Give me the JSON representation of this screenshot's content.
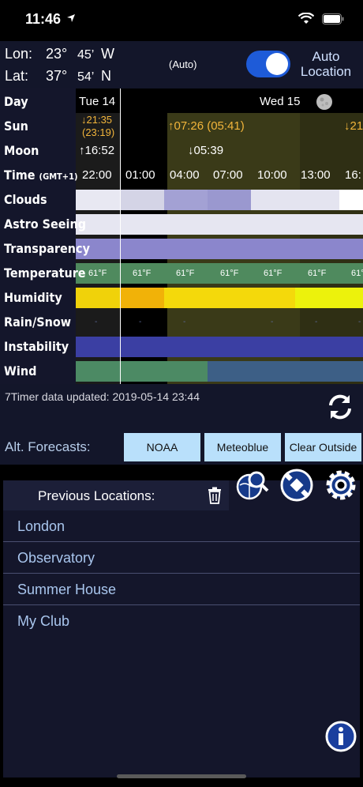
{
  "status": {
    "time": "11:46"
  },
  "location": {
    "lon_label": "Lon:",
    "lon_deg": "23°",
    "lon_min": "45’",
    "lon_dir": "W",
    "lat_label": "Lat:",
    "lat_deg": "37°",
    "lat_min": "54’",
    "lat_dir": "N",
    "auto_tag": "(Auto)",
    "auto_location_line1": "Auto",
    "auto_location_line2": "Location",
    "auto_location_enabled": true
  },
  "rows": {
    "day": "Day",
    "sun": "Sun",
    "moon": "Moon",
    "time": "Time",
    "time_zone": "(GMT+1)",
    "clouds": "Clouds",
    "seeing": "Astro Seeing",
    "transparency": "Transparency",
    "temperature": "Temperature",
    "humidity": "Humidity",
    "rain": "Rain/Snow",
    "instability": "Instability",
    "wind": "Wind"
  },
  "days": {
    "day1": "Tue 14",
    "day2": "Wed 15"
  },
  "sun": {
    "set1": "↓21:35",
    "set1_sub": "(23:19)",
    "rise": "↑07:26 (05:41)",
    "set2": "↓21"
  },
  "moon": {
    "rise": "↑16:52",
    "set": "↓05:39"
  },
  "times": [
    "22:00",
    "01:00",
    "04:00",
    "07:00",
    "10:00",
    "13:00",
    "16:"
  ],
  "temps": [
    "61°F",
    "61°F",
    "61°F",
    "61°F",
    "61°F",
    "61°F",
    "61°"
  ],
  "updated_text": "7Timer data updated: 2019-05-14 23:44",
  "alt": {
    "label": "Alt. Forecasts:",
    "noaa": "NOAA",
    "meteoblue": "Meteoblue",
    "clear_outside": "Clear Outside"
  },
  "prev": {
    "title": "Previous Locations:",
    "items": [
      "London",
      "Observatory",
      "Summer House",
      "My Club"
    ]
  },
  "colors": {
    "accent": "#1e5bd8",
    "sun_text": "#f2b53b",
    "alt_button": "#b9e0fb",
    "list_text": "#a9c6ee"
  }
}
